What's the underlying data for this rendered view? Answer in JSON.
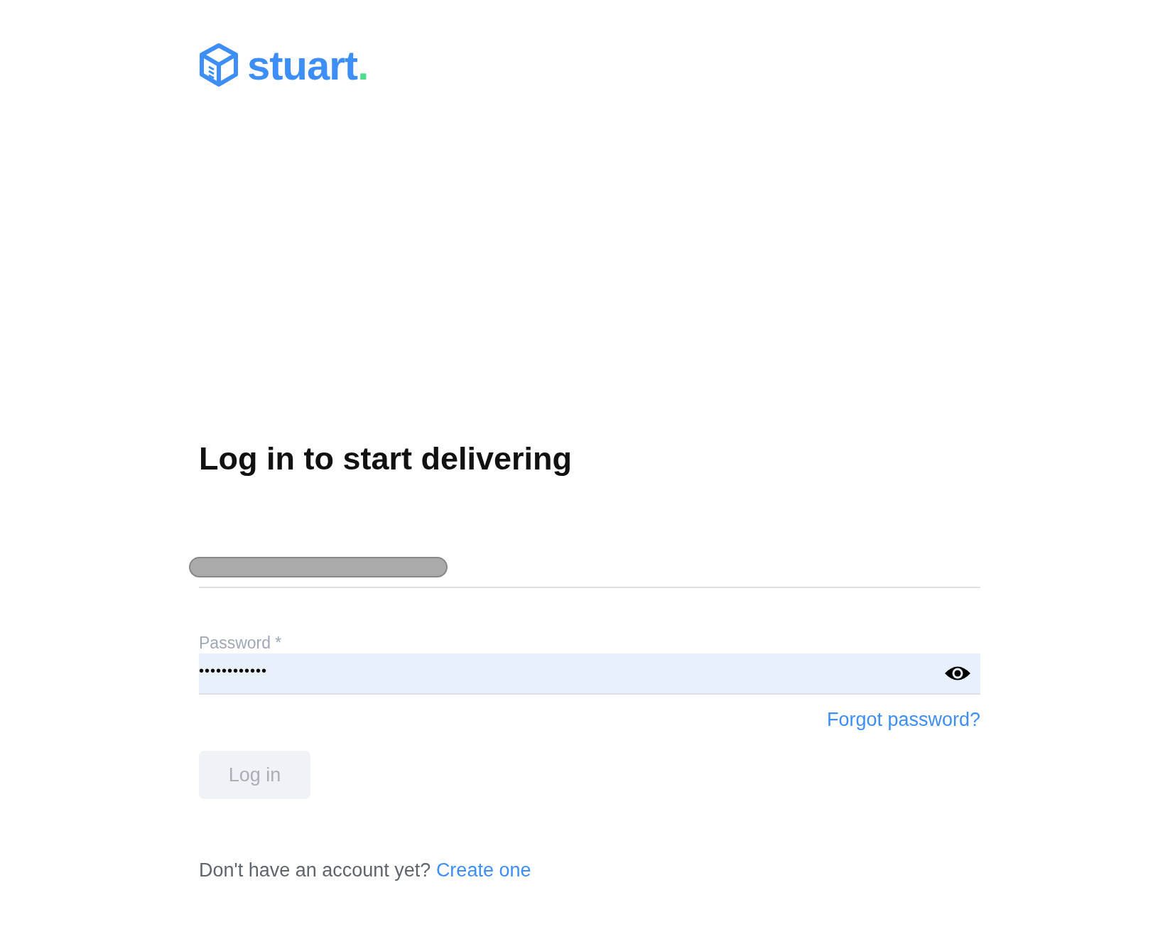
{
  "logo": {
    "name": "stuart",
    "dot": "."
  },
  "heading": "Log in to start delivering",
  "email_field": {
    "redacted": true
  },
  "password_field": {
    "label": "Password *",
    "value": "••••••••••••",
    "show_toggle": true
  },
  "forgot_link": "Forgot password?",
  "login_button": {
    "label": "Log in",
    "disabled": true
  },
  "signup": {
    "text": "Don't have an account yet?",
    "link": "Create one"
  }
}
